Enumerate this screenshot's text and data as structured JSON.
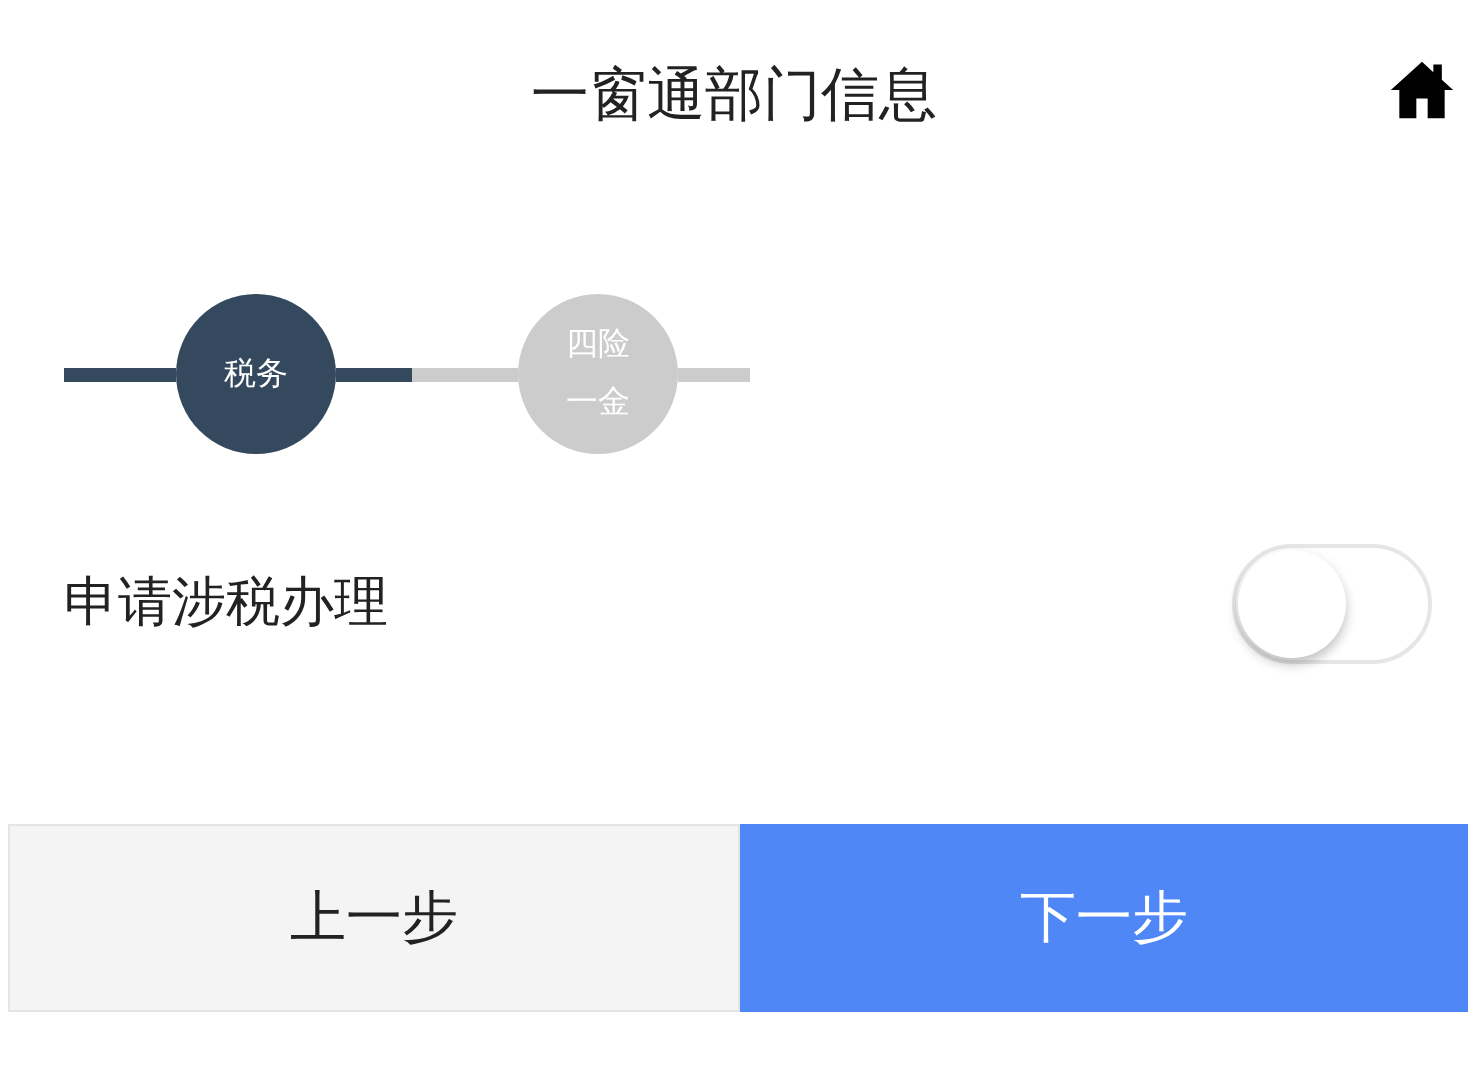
{
  "header": {
    "title": "一窗通部门信息"
  },
  "steps": [
    {
      "label": "税务",
      "selected": true
    },
    {
      "label": "四险一金",
      "selected": false
    }
  ],
  "setting": {
    "label": "申请涉税办理",
    "on": false
  },
  "buttons": [
    {
      "label": "上一步",
      "kind": "secondary"
    },
    {
      "label": "下一步",
      "kind": "primary"
    }
  ]
}
